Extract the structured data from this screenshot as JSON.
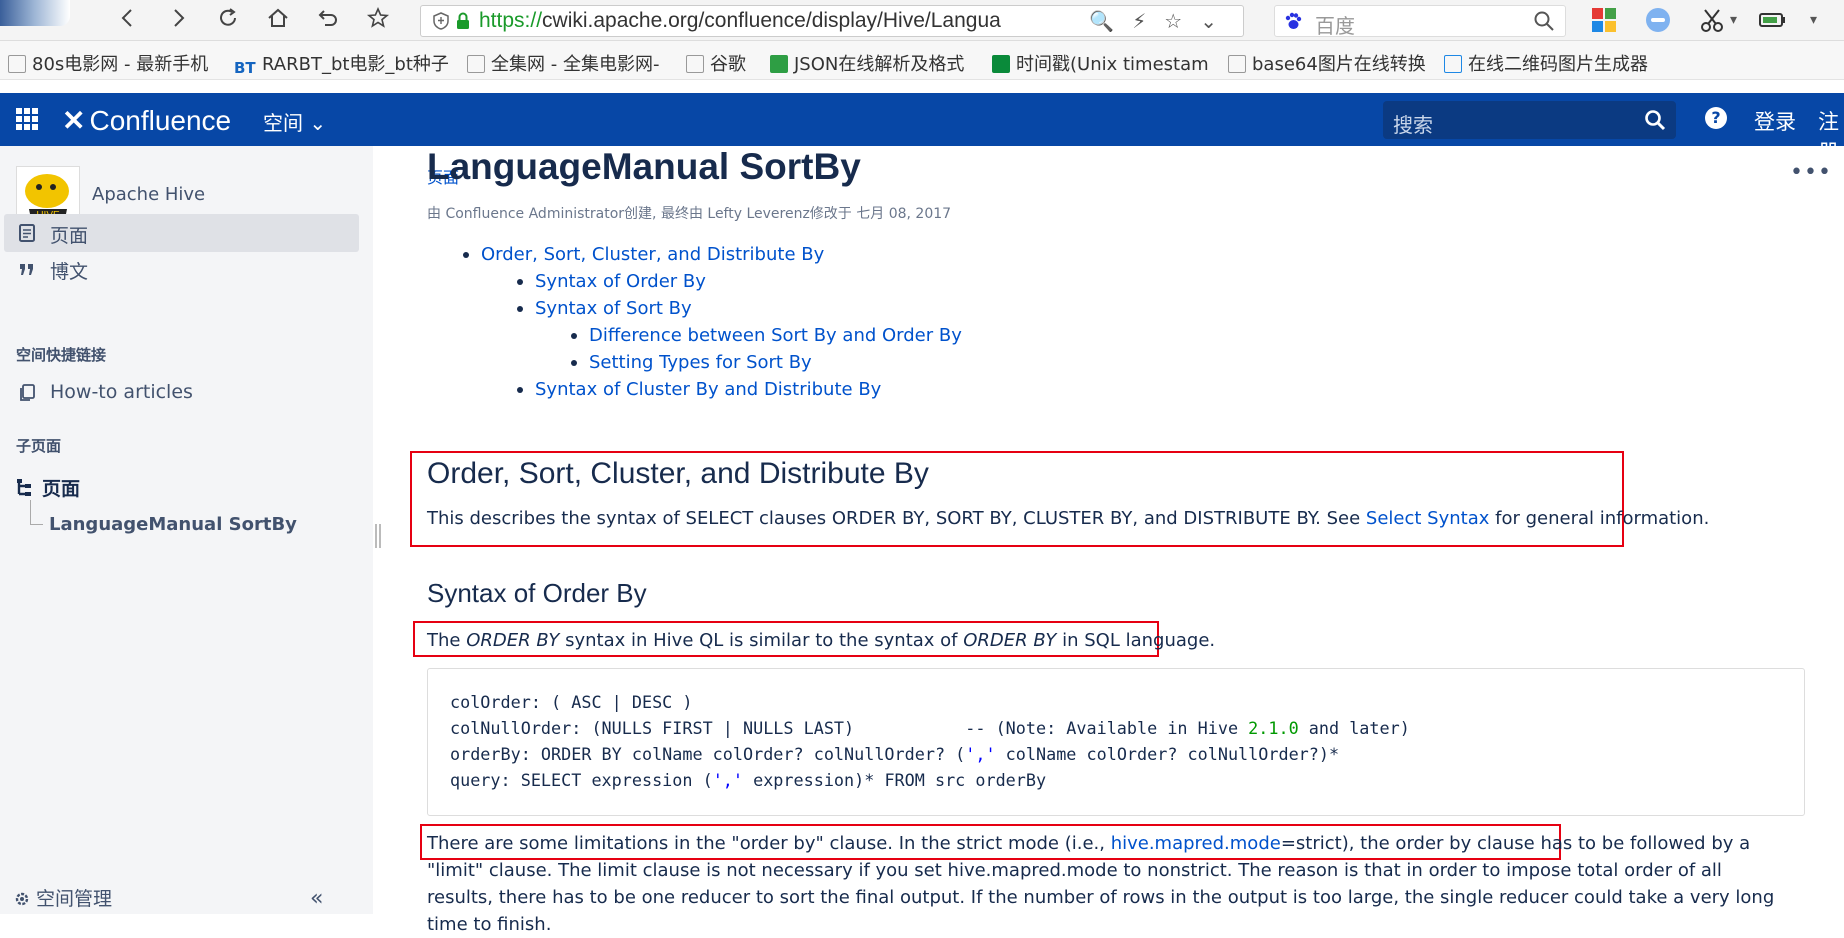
{
  "browser": {
    "url_scheme": "https://",
    "url_rest": "cwiki.apache.org/confluence/display/Hive/Langua",
    "search_engine_placeholder": "百度"
  },
  "bookmarks": [
    {
      "label": "80s电影网 - 最新手机"
    },
    {
      "label": "RARBT_bt电影_bt种子"
    },
    {
      "label": "全集网 - 全集电影网-"
    },
    {
      "label": "谷歌"
    },
    {
      "label": "JSON在线解析及格式"
    },
    {
      "label": "时间戳(Unix timestam"
    },
    {
      "label": "base64图片在线转换"
    },
    {
      "label": "在线二维码图片生成器"
    }
  ],
  "header": {
    "logo_text": "Confluence",
    "spaces_label": "空间",
    "search_placeholder": "搜索",
    "help_label": "?",
    "login_label": "登录",
    "register_label": "注册"
  },
  "sidebar": {
    "space_name": "Apache Hive",
    "nav": [
      {
        "label": "页面"
      },
      {
        "label": "博文"
      }
    ],
    "shortcuts_heading": "空间快捷链接",
    "shortcuts": [
      {
        "label": "How-to articles"
      }
    ],
    "children_heading": "子页面",
    "tree_root": "页面",
    "tree_child": "LanguageManual SortBy",
    "space_admin": "空间管理",
    "collapse_label": "«"
  },
  "page": {
    "breadcrumb": "页面",
    "title": "LanguageManual SortBy",
    "byline": "由 Confluence Administrator创建, 最终由 Lefty Leverenz修改于 七月 08, 2017",
    "more_label": "•••",
    "toc": [
      {
        "label": "Order, Sort, Cluster, and Distribute By",
        "level": 1
      },
      {
        "label": "Syntax of Order By",
        "level": 2
      },
      {
        "label": "Syntax of Sort By",
        "level": 2
      },
      {
        "label": "Difference between Sort By and Order By",
        "level": 3
      },
      {
        "label": "Setting Types for Sort By",
        "level": 3
      },
      {
        "label": "Syntax of Cluster By and Distribute By",
        "level": 2
      }
    ],
    "section1": {
      "heading": "Order, Sort, Cluster, and Distribute By",
      "text_before": "This describes the syntax of SELECT clauses ORDER BY, SORT BY, CLUSTER BY, and DISTRIBUTE BY.  See ",
      "link": "Select Syntax",
      "text_after": " for general information."
    },
    "section2": {
      "heading": "Syntax of Order By",
      "p1_a": "The ",
      "p1_em1": "ORDER BY",
      "p1_b": " syntax in Hive QL is similar to the syntax of ",
      "p1_em2": "ORDER BY",
      "p1_c": " in SQL language.",
      "code_lines": [
        "colOrder: ( ASC | DESC )",
        "colNullOrder: (NULLS FIRST | NULLS LAST)           -- (Note: Available in Hive ",
        "2.1.0",
        " and later)",
        "orderBy: ORDER BY colName colOrder? colNullOrder? (",
        "','",
        " colName colOrder? colNullOrder?)*",
        "query: SELECT expression (",
        "','",
        " expression)* FROM src orderBy"
      ],
      "p2_a": "There are some limitations in the \"order by\" clause. In the strict mode (i.e., ",
      "p2_link": "hive.mapred.mode",
      "p2_b": "=strict), the order by clause has to be followed by a \"limit\" clause. The limit clause is not necessary if you set hive.mapred.mode to nonstrict. The reason is that in order to impose total order of all results, there has to be one reducer to sort the final output. If the number of rows in the output is too large, the single reducer could take a very long time to finish."
    }
  },
  "colors": {
    "header_bg": "#0747a6",
    "link": "#0052cc",
    "highlight_box": "#e60012"
  }
}
